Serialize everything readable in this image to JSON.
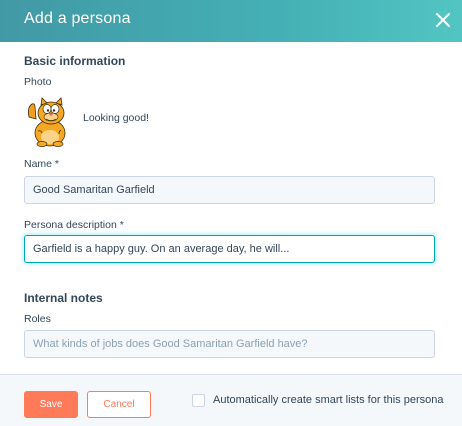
{
  "modal": {
    "title": "Add a persona"
  },
  "basic": {
    "section_title": "Basic information",
    "photo_label": "Photo",
    "photo_caption": "Looking good!",
    "name_label": "Name *",
    "name_value": "Good Samaritan Garfield",
    "description_label": "Persona description *",
    "description_value": "Garfield is a happy guy. On an average day, he will..."
  },
  "internal": {
    "section_title": "Internal notes",
    "roles_label": "Roles",
    "roles_placeholder": "What kinds of jobs does Good Samaritan Garfield have?"
  },
  "footer": {
    "save_label": "Save",
    "cancel_label": "Cancel",
    "smart_lists_label": "Automatically create smart lists for this persona",
    "smart_lists_checked": false
  },
  "icons": {
    "close": "close-icon",
    "avatar": "garfield-avatar"
  },
  "colors": {
    "header_gradient_start": "#4299a5",
    "header_gradient_end": "#52c5c2",
    "accent": "#ff7a59",
    "focus": "#00a4bd",
    "text": "#33475b"
  }
}
